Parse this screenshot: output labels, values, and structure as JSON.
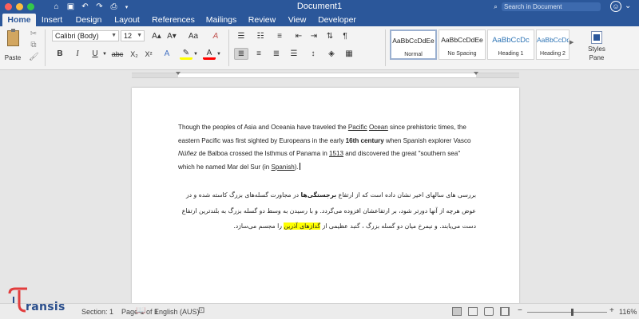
{
  "window": {
    "title": "Document1",
    "search_placeholder": "Search in Document"
  },
  "tabs": [
    "Home",
    "Insert",
    "Design",
    "Layout",
    "References",
    "Mailings",
    "Review",
    "View",
    "Developer"
  ],
  "active_tab": "Home",
  "ribbon": {
    "paste_label": "Paste",
    "font_name": "Calibri (Body)",
    "font_size": "12",
    "buttons": {
      "grow": "A▴",
      "shrink": "A▾",
      "change_case": "Aa",
      "clear_format": "A",
      "bold": "B",
      "italic": "I",
      "underline": "U",
      "strikethrough": "abc",
      "subscript": "X₂",
      "superscript": "X²",
      "text_effects": "A",
      "highlight": "✎",
      "font_color": "A",
      "show_marks": "¶"
    },
    "colors": {
      "highlight": "#ffff00",
      "font_color": "#ff0000",
      "brand": "#2b579a"
    },
    "styles": [
      {
        "sample": "AaBbCcDdEe",
        "name": "Normal",
        "selected": true
      },
      {
        "sample": "AaBbCcDdEe",
        "name": "No Spacing",
        "selected": false
      },
      {
        "sample": "AaBbCcDc",
        "name": "Heading 1",
        "selected": false
      },
      {
        "sample": "AaBbCcDdE",
        "name": "Heading 2",
        "selected": false
      }
    ],
    "styles_pane_label_1": "Styles",
    "styles_pane_label_2": "Pane"
  },
  "document": {
    "en": {
      "s1": "Though the peoples of Asia and Oceania have traveled the ",
      "pacific": "Pacific",
      "s2": " ",
      "ocean": "Ocean",
      "s3": " since prehistoric times, the eastern Pacific was first sighted by Europeans in the early ",
      "century": "16th century",
      "s4": " when Spanish explorer Vasco ",
      "nunez": "Núñez",
      "s5": " de Balboa crossed the Isthmus of Panama in ",
      "year": "1513",
      "s6": " and discovered the great \"southern sea\" which he named Mar del Sur (in ",
      "spanish": "Spanish",
      "s7": ")."
    },
    "fa": {
      "p1": "بررسی های سالهای اخیر نشان داده است که از ارتفاع ",
      "bold": "برجستگی‌ها",
      "p2": " در مجاورت گسله‌های بزرگ کاسته شده و در عوض هرچه از آنها دورتر شود، بر ارتفاعشان افزوده می‌گردد. و با رسیدن به وسط دو گسله بزرگ به بلندترین ارتفاع دست می‌یابند. و نیمرخ میان دو گسله بزرگ ، گنبد عظیمی از ",
      "highlight": "گدازهای آذرین",
      "p3": " را مجسم می‌سازد."
    }
  },
  "statusbar": {
    "section": "Section: 1",
    "page": "Page 1 of 1",
    "language": "English (AUS)",
    "zoom": "116%",
    "zoom_minus": "−",
    "zoom_plus": "+"
  },
  "logo": {
    "text": "ransis"
  }
}
